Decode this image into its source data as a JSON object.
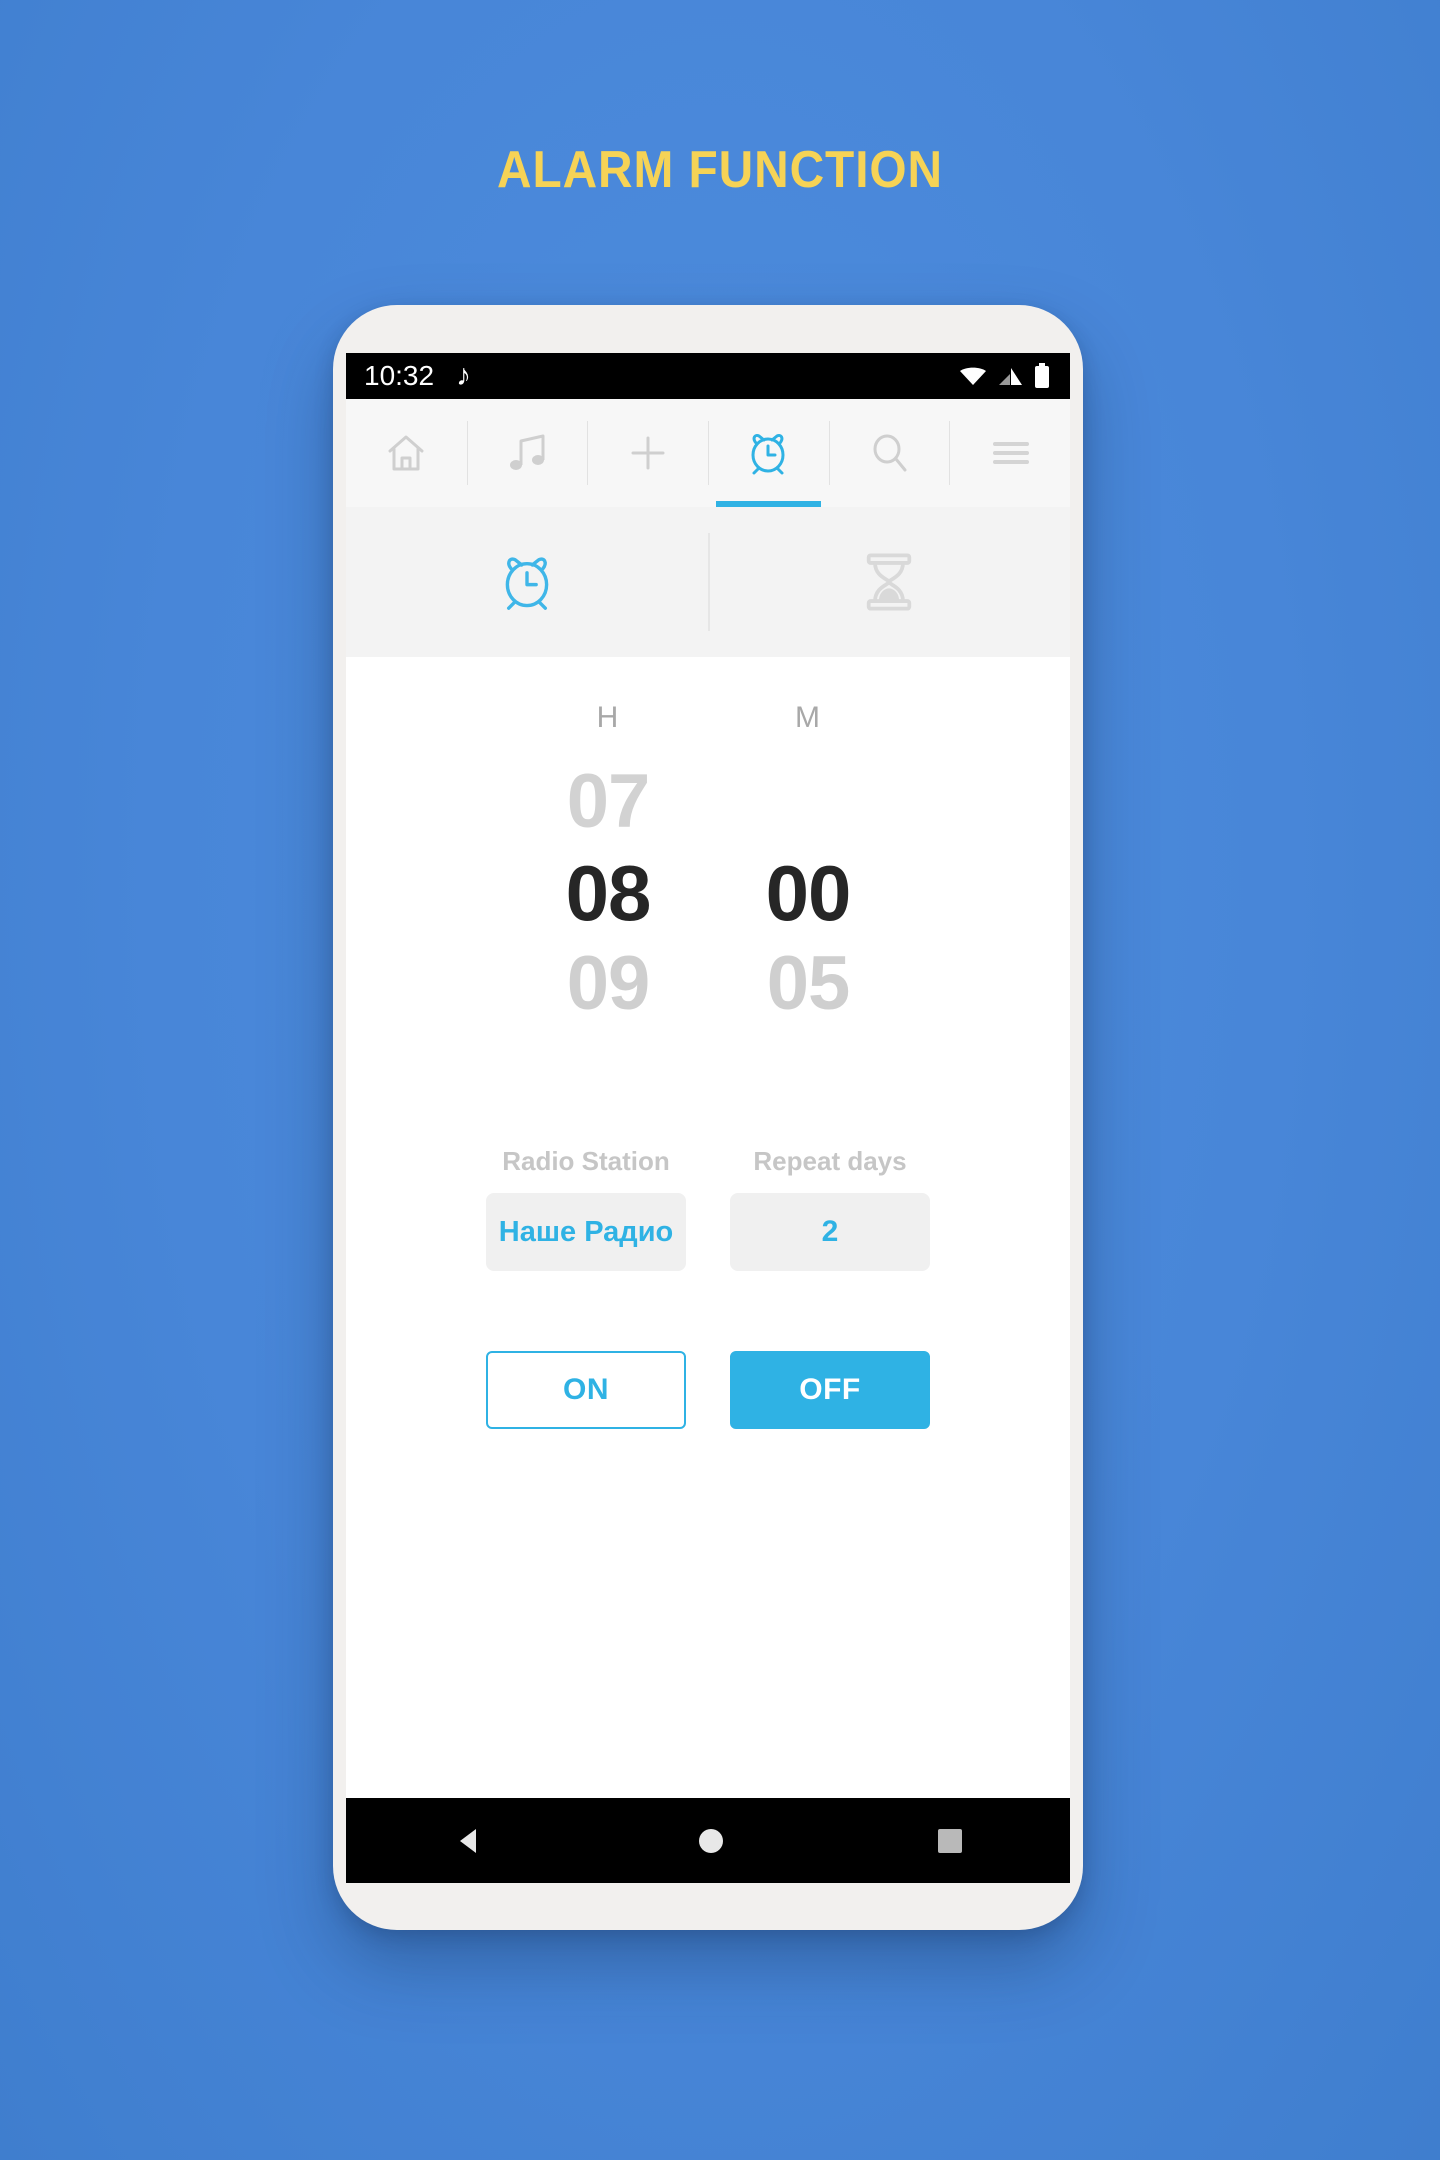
{
  "page": {
    "title": "ALARM FUNCTION",
    "background_color": "#4886d8",
    "title_color": "#f6d356",
    "accent_color": "#2fb2e4"
  },
  "statusbar": {
    "time": "10:32",
    "music_icon": "music-note-icon",
    "wifi_icon": "wifi-icon",
    "signal_icon": "cellular-signal-icon",
    "battery_icon": "battery-icon"
  },
  "topnav": {
    "items": [
      {
        "name": "home",
        "icon": "home-icon",
        "active": false
      },
      {
        "name": "music",
        "icon": "music-note-icon",
        "active": false
      },
      {
        "name": "add",
        "icon": "plus-icon",
        "active": false
      },
      {
        "name": "alarm",
        "icon": "alarm-clock-icon",
        "active": true
      },
      {
        "name": "search",
        "icon": "search-icon",
        "active": false
      },
      {
        "name": "menu",
        "icon": "hamburger-menu-icon",
        "active": false
      }
    ]
  },
  "subtabs": {
    "items": [
      {
        "name": "alarm",
        "icon": "alarm-clock-icon",
        "active": true
      },
      {
        "name": "timer",
        "icon": "hourglass-icon",
        "active": false
      }
    ]
  },
  "picker": {
    "hours": {
      "label": "H",
      "previous": "07",
      "selected": "08",
      "next": "09"
    },
    "minutes": {
      "label": "M",
      "previous": "",
      "selected": "00",
      "next": "05"
    }
  },
  "fields": {
    "radio_station": {
      "label": "Radio Station",
      "value": "Наше Радио"
    },
    "repeat_days": {
      "label": "Repeat days",
      "value": "2"
    }
  },
  "buttons": {
    "on": "ON",
    "off": "OFF"
  },
  "android_navbar": {
    "back_icon": "back-triangle-icon",
    "home_icon": "home-circle-icon",
    "recents_icon": "recents-square-icon"
  }
}
